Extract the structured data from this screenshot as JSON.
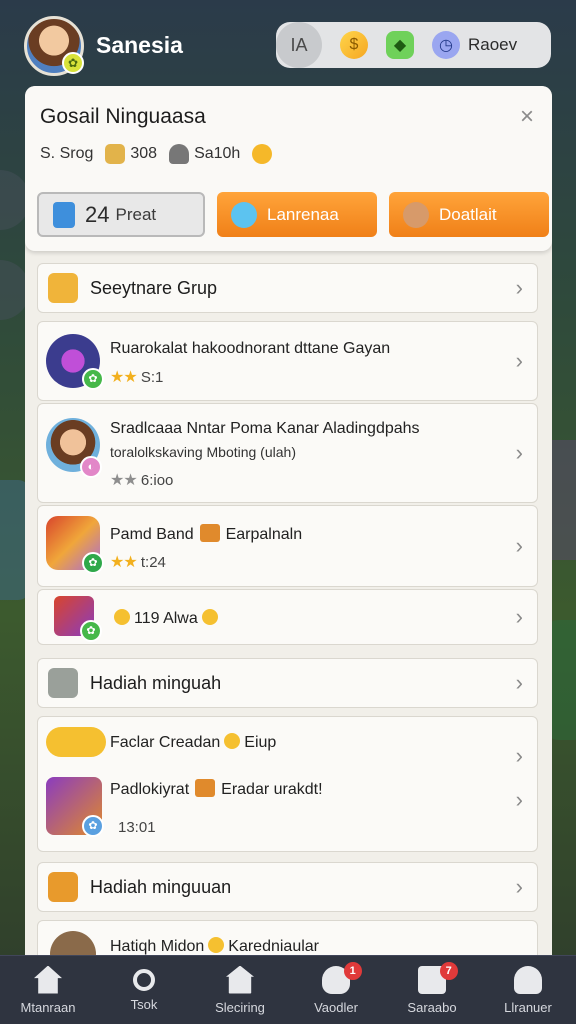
{
  "player": {
    "name": "Sanesia"
  },
  "resources": {
    "tag": "IA",
    "label": "Raoev",
    "icons": [
      "coin-icon",
      "gem-icon",
      "clock-icon"
    ]
  },
  "panel": {
    "title": "Gosail Ninguaasa",
    "close_icon": "×",
    "stats": [
      {
        "icon": "",
        "value": "S. Srog"
      },
      {
        "icon": "box-icon",
        "value": "308"
      },
      {
        "icon": "person-icon",
        "value": "Sa10h"
      }
    ],
    "tabs": [
      {
        "number": "24",
        "label": "Preat",
        "style": "grey"
      },
      {
        "number": "",
        "label": "Lanrenaa",
        "style": "orange"
      },
      {
        "number": "",
        "label": "Doatlait",
        "style": "orange"
      }
    ]
  },
  "sections": [
    {
      "label": "Seeytnare Grup"
    },
    {
      "label": "Hadiah minguah"
    },
    {
      "label": "Hadiah minguuan"
    }
  ],
  "items_group1": [
    {
      "title": "Ruarokalat hakoodnorant dttane Gayan",
      "sub": "",
      "meta": "S:1",
      "stars": "★★",
      "star_style": "gold",
      "colors": [
        "#3b3c8e",
        "#46b84a"
      ]
    },
    {
      "title": "Sradlcaaa Nntar Poma Kanar Aladingdpahs",
      "sub": "toralolkskaving Mboting (ulah)",
      "meta": "6:ioo",
      "stars": "★★",
      "star_style": "grey",
      "colors": [
        "#6fb0dc",
        "#e287c8"
      ]
    },
    {
      "title": "Pamd Band",
      "sub": "",
      "title_extra": "Earpalnaln",
      "meta": "t:24",
      "stars": "★★",
      "star_style": "gold",
      "colors": [
        "#d8452c",
        "#2fa84a"
      ]
    },
    {
      "title": "119 Alwa",
      "sub": "",
      "meta": "",
      "stars": "",
      "star_style": "none",
      "colors": [
        "#8a3cbf",
        "#46b84a"
      ]
    }
  ],
  "items_group2": [
    {
      "title": "Faclar Creadan",
      "title_extra": "Eiup"
    },
    {
      "title": "Padlokiyrat",
      "title_extra": "Eradar urakdt!",
      "meta": "13:01"
    }
  ],
  "items_group3": [
    {
      "title": "Hatiqh Midon",
      "title_extra": "Karedniaular"
    }
  ],
  "nav": [
    {
      "label": "Mtanraan",
      "icon": "home-icon",
      "badge": ""
    },
    {
      "label": "Tsok",
      "icon": "search-icon",
      "badge": ""
    },
    {
      "label": "Sleciring",
      "icon": "building-icon",
      "badge": ""
    },
    {
      "label": "Vaodler",
      "icon": "heart-icon",
      "badge": "1"
    },
    {
      "label": "Saraabo",
      "icon": "box-icon",
      "badge": "7"
    },
    {
      "label": "Llranuer",
      "icon": "user-icon",
      "badge": ""
    }
  ]
}
